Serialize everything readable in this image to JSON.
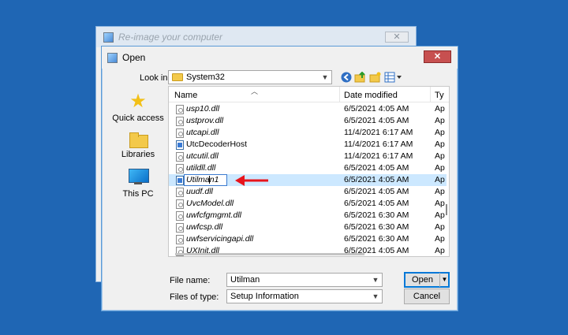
{
  "background_window": {
    "title": "Re-image your computer",
    "close_glyph": "✕"
  },
  "dialog": {
    "title": "Open",
    "close_glyph": "✕",
    "look_in": {
      "label": "Look in:",
      "value": "System32"
    },
    "places": [
      {
        "label": "Quick access",
        "icon": "star-icon"
      },
      {
        "label": "Libraries",
        "icon": "folder-icon"
      },
      {
        "label": "This PC",
        "icon": "computer-icon"
      }
    ],
    "columns": {
      "name": "Name",
      "date": "Date modified",
      "type": "Ty"
    },
    "files": [
      {
        "name": "usp10.dll",
        "date": "6/5/2021 4:05 AM",
        "type": "Ap",
        "icon": "dll-icon"
      },
      {
        "name": "ustprov.dll",
        "date": "6/5/2021 4:05 AM",
        "type": "Ap",
        "icon": "dll-icon"
      },
      {
        "name": "utcapi.dll",
        "date": "11/4/2021 6:17 AM",
        "type": "Ap",
        "icon": "dll-icon"
      },
      {
        "name": "UtcDecoderHost",
        "date": "11/4/2021 6:17 AM",
        "type": "Ap",
        "icon": "exe-icon"
      },
      {
        "name": "utcutil.dll",
        "date": "11/4/2021 6:17 AM",
        "type": "Ap",
        "icon": "dll-icon"
      },
      {
        "name": "utildll.dll",
        "date": "6/5/2021 4:05 AM",
        "type": "Ap",
        "icon": "dll-icon"
      },
      {
        "name": "Utilman1",
        "date": "6/5/2021 4:05 AM",
        "type": "Ap",
        "icon": "exe-icon",
        "renaming": true
      },
      {
        "name": "uudf.dll",
        "date": "6/5/2021 4:05 AM",
        "type": "Ap",
        "icon": "dll-icon"
      },
      {
        "name": "UvcModel.dll",
        "date": "6/5/2021 4:05 AM",
        "type": "Ap",
        "icon": "dll-icon"
      },
      {
        "name": "uwfcfgmgmt.dll",
        "date": "6/5/2021 6:30 AM",
        "type": "Ap",
        "icon": "dll-icon"
      },
      {
        "name": "uwfcsp.dll",
        "date": "6/5/2021 6:30 AM",
        "type": "Ap",
        "icon": "dll-icon"
      },
      {
        "name": "uwfservicingapi.dll",
        "date": "6/5/2021 6:30 AM",
        "type": "Ap",
        "icon": "dll-icon"
      },
      {
        "name": "UXInit.dll",
        "date": "6/5/2021 4:05 AM",
        "type": "Ap",
        "icon": "dll-icon"
      }
    ],
    "file_name": {
      "label": "File name:",
      "value": "Utilman"
    },
    "files_of_type": {
      "label": "Files of type:",
      "value": "Setup Information"
    },
    "open_button": "Open",
    "cancel_button": "Cancel"
  },
  "annotation": {
    "arrow_color": "#e8141c"
  }
}
